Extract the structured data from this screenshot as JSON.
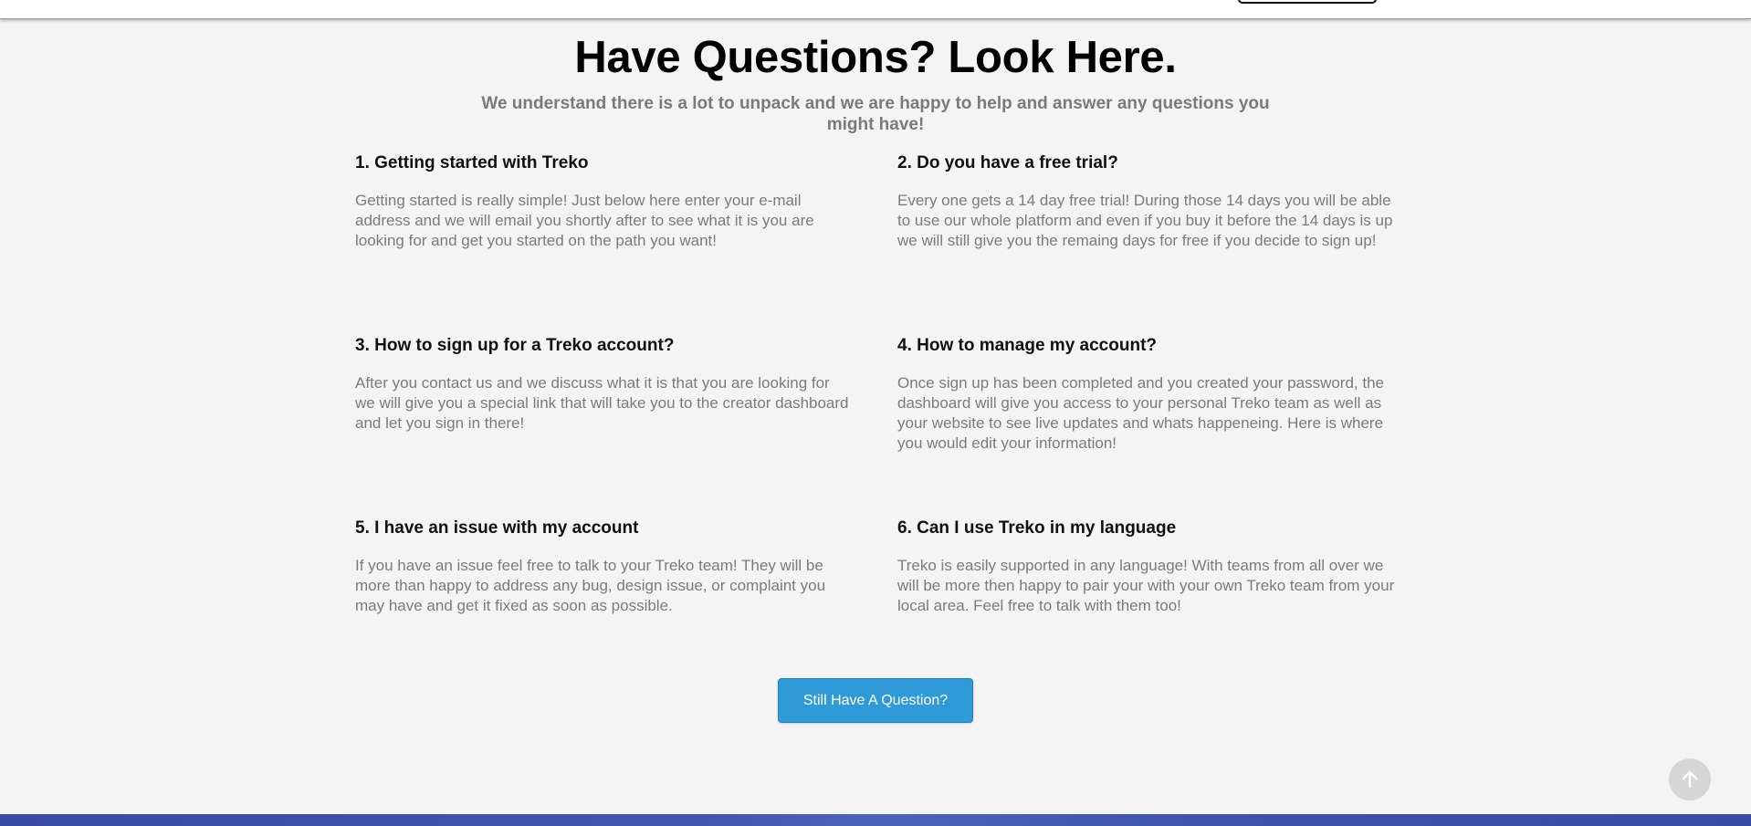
{
  "faq": {
    "title": "Have Questions? Look Here.",
    "subtitle": "We understand there is a lot to unpack and we are happy to help and answer any questions you might have!",
    "items": [
      {
        "question": "1. Getting started with Treko",
        "answer": "Getting started is really simple! Just below here enter your e-mail address and we will email you shortly after to see what it is you are looking for and get you started on the path you want!"
      },
      {
        "question": "2. Do you have a free trial?",
        "answer": "Every one gets a 14 day free trial! During those 14 days you will be able to use our whole platform and even if you buy it before the 14 days is up we will still give you the remaing days for free if you decide to sign up!"
      },
      {
        "question": "3. How to sign up for a Treko account?",
        "answer": "After you contact us and we discuss what it is that you are looking for we will give you a special link that will take you to the creator dashboard and let you sign in there!"
      },
      {
        "question": "4. How to manage my account?",
        "answer": "Once sign up has been completed and you created your password, the dashboard will give you access to your personal Treko team as well as your website to see live updates and whats happeneing. Here is where you would edit your information!"
      },
      {
        "question": "5. I have an issue with my account",
        "answer": "If you have an issue feel free to talk to your Treko team! They will be more than happy to address any bug, design issue, or complaint you may have and get it fixed as soon as possible."
      },
      {
        "question": "6. Can I use Treko in my language",
        "answer": "Treko is easily supported in any language! With teams from all over we will be more then happy to pair your with your own Treko team from your local area. Feel free to talk with them too!"
      }
    ],
    "cta_label": "Still Have A Question?"
  },
  "scroll_top": {
    "icon": "arrow-up-icon"
  },
  "colors": {
    "background": "#f4f4f4",
    "cta": "#2f9ad8",
    "footer": "#3b4aa5",
    "answer_text": "#7b7b7b"
  }
}
